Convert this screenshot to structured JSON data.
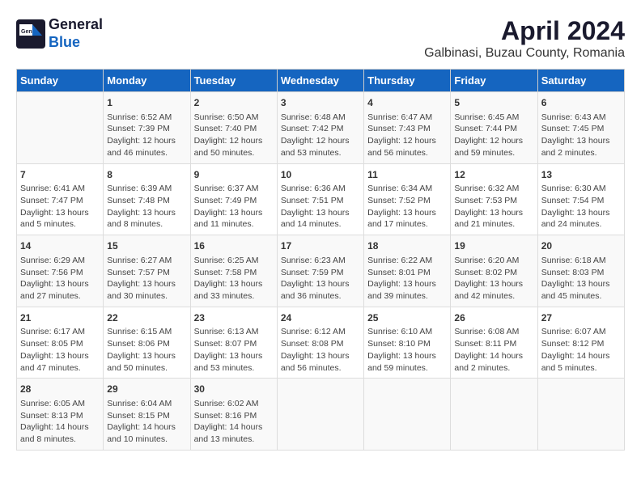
{
  "header": {
    "logo_line1": "General",
    "logo_line2": "Blue",
    "title": "April 2024",
    "subtitle": "Galbinasi, Buzau County, Romania"
  },
  "days_of_week": [
    "Sunday",
    "Monday",
    "Tuesday",
    "Wednesday",
    "Thursday",
    "Friday",
    "Saturday"
  ],
  "weeks": [
    [
      {
        "day": "",
        "content": ""
      },
      {
        "day": "1",
        "content": "Sunrise: 6:52 AM\nSunset: 7:39 PM\nDaylight: 12 hours\nand 46 minutes."
      },
      {
        "day": "2",
        "content": "Sunrise: 6:50 AM\nSunset: 7:40 PM\nDaylight: 12 hours\nand 50 minutes."
      },
      {
        "day": "3",
        "content": "Sunrise: 6:48 AM\nSunset: 7:42 PM\nDaylight: 12 hours\nand 53 minutes."
      },
      {
        "day": "4",
        "content": "Sunrise: 6:47 AM\nSunset: 7:43 PM\nDaylight: 12 hours\nand 56 minutes."
      },
      {
        "day": "5",
        "content": "Sunrise: 6:45 AM\nSunset: 7:44 PM\nDaylight: 12 hours\nand 59 minutes."
      },
      {
        "day": "6",
        "content": "Sunrise: 6:43 AM\nSunset: 7:45 PM\nDaylight: 13 hours\nand 2 minutes."
      }
    ],
    [
      {
        "day": "7",
        "content": "Sunrise: 6:41 AM\nSunset: 7:47 PM\nDaylight: 13 hours\nand 5 minutes."
      },
      {
        "day": "8",
        "content": "Sunrise: 6:39 AM\nSunset: 7:48 PM\nDaylight: 13 hours\nand 8 minutes."
      },
      {
        "day": "9",
        "content": "Sunrise: 6:37 AM\nSunset: 7:49 PM\nDaylight: 13 hours\nand 11 minutes."
      },
      {
        "day": "10",
        "content": "Sunrise: 6:36 AM\nSunset: 7:51 PM\nDaylight: 13 hours\nand 14 minutes."
      },
      {
        "day": "11",
        "content": "Sunrise: 6:34 AM\nSunset: 7:52 PM\nDaylight: 13 hours\nand 17 minutes."
      },
      {
        "day": "12",
        "content": "Sunrise: 6:32 AM\nSunset: 7:53 PM\nDaylight: 13 hours\nand 21 minutes."
      },
      {
        "day": "13",
        "content": "Sunrise: 6:30 AM\nSunset: 7:54 PM\nDaylight: 13 hours\nand 24 minutes."
      }
    ],
    [
      {
        "day": "14",
        "content": "Sunrise: 6:29 AM\nSunset: 7:56 PM\nDaylight: 13 hours\nand 27 minutes."
      },
      {
        "day": "15",
        "content": "Sunrise: 6:27 AM\nSunset: 7:57 PM\nDaylight: 13 hours\nand 30 minutes."
      },
      {
        "day": "16",
        "content": "Sunrise: 6:25 AM\nSunset: 7:58 PM\nDaylight: 13 hours\nand 33 minutes."
      },
      {
        "day": "17",
        "content": "Sunrise: 6:23 AM\nSunset: 7:59 PM\nDaylight: 13 hours\nand 36 minutes."
      },
      {
        "day": "18",
        "content": "Sunrise: 6:22 AM\nSunset: 8:01 PM\nDaylight: 13 hours\nand 39 minutes."
      },
      {
        "day": "19",
        "content": "Sunrise: 6:20 AM\nSunset: 8:02 PM\nDaylight: 13 hours\nand 42 minutes."
      },
      {
        "day": "20",
        "content": "Sunrise: 6:18 AM\nSunset: 8:03 PM\nDaylight: 13 hours\nand 45 minutes."
      }
    ],
    [
      {
        "day": "21",
        "content": "Sunrise: 6:17 AM\nSunset: 8:05 PM\nDaylight: 13 hours\nand 47 minutes."
      },
      {
        "day": "22",
        "content": "Sunrise: 6:15 AM\nSunset: 8:06 PM\nDaylight: 13 hours\nand 50 minutes."
      },
      {
        "day": "23",
        "content": "Sunrise: 6:13 AM\nSunset: 8:07 PM\nDaylight: 13 hours\nand 53 minutes."
      },
      {
        "day": "24",
        "content": "Sunrise: 6:12 AM\nSunset: 8:08 PM\nDaylight: 13 hours\nand 56 minutes."
      },
      {
        "day": "25",
        "content": "Sunrise: 6:10 AM\nSunset: 8:10 PM\nDaylight: 13 hours\nand 59 minutes."
      },
      {
        "day": "26",
        "content": "Sunrise: 6:08 AM\nSunset: 8:11 PM\nDaylight: 14 hours\nand 2 minutes."
      },
      {
        "day": "27",
        "content": "Sunrise: 6:07 AM\nSunset: 8:12 PM\nDaylight: 14 hours\nand 5 minutes."
      }
    ],
    [
      {
        "day": "28",
        "content": "Sunrise: 6:05 AM\nSunset: 8:13 PM\nDaylight: 14 hours\nand 8 minutes."
      },
      {
        "day": "29",
        "content": "Sunrise: 6:04 AM\nSunset: 8:15 PM\nDaylight: 14 hours\nand 10 minutes."
      },
      {
        "day": "30",
        "content": "Sunrise: 6:02 AM\nSunset: 8:16 PM\nDaylight: 14 hours\nand 13 minutes."
      },
      {
        "day": "",
        "content": ""
      },
      {
        "day": "",
        "content": ""
      },
      {
        "day": "",
        "content": ""
      },
      {
        "day": "",
        "content": ""
      }
    ]
  ]
}
